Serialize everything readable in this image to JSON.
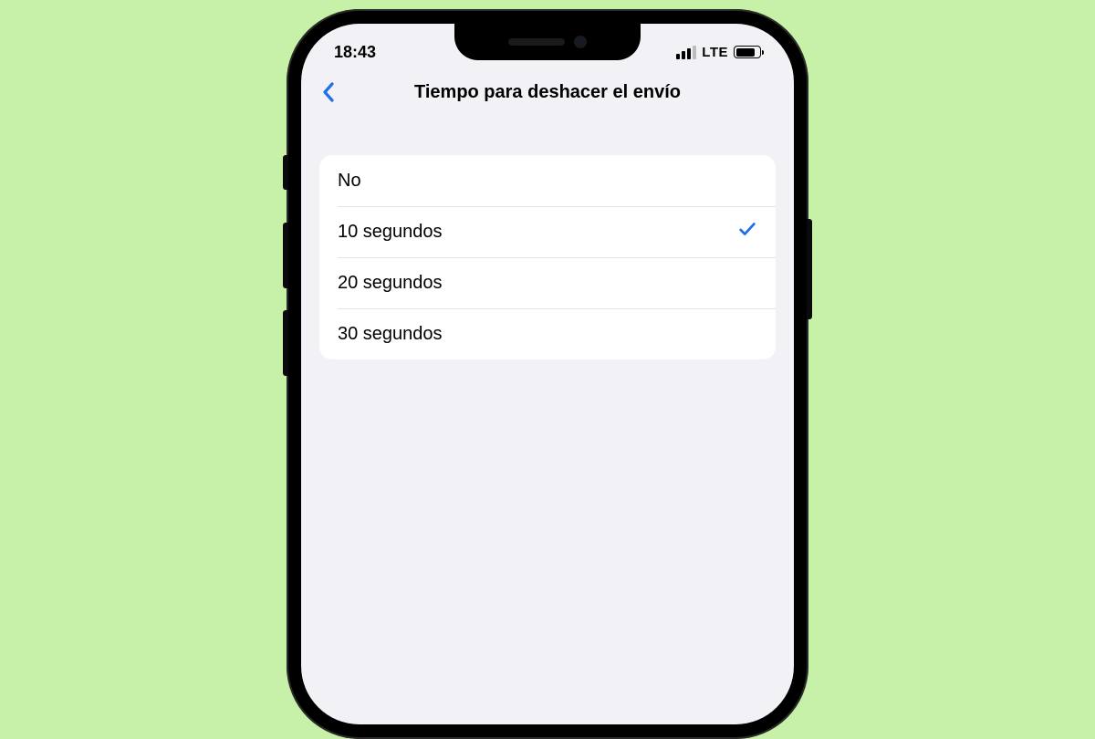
{
  "status": {
    "time": "18:43",
    "network_label": "LTE"
  },
  "nav": {
    "title": "Tiempo para deshacer el envío"
  },
  "options": {
    "items": [
      {
        "label": "No",
        "selected": false
      },
      {
        "label": "10 segundos",
        "selected": true
      },
      {
        "label": "20 segundos",
        "selected": false
      },
      {
        "label": "30 segundos",
        "selected": false
      }
    ]
  },
  "colors": {
    "accent": "#1f6feb",
    "page_bg": "#c7f0a8",
    "screen_bg": "#f2f1f6"
  }
}
